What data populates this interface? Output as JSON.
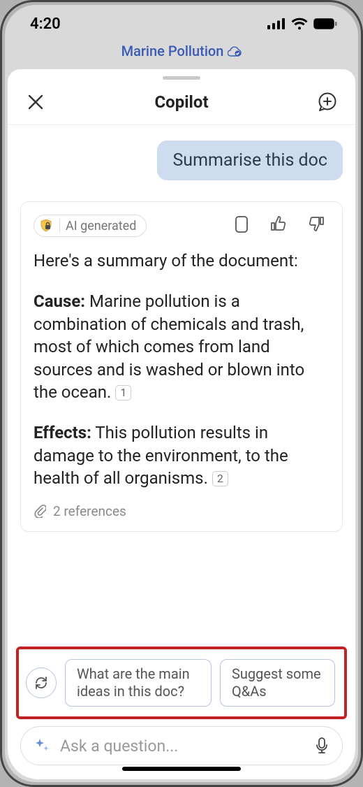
{
  "status": {
    "time": "4:20"
  },
  "doc": {
    "title": "Marine Pollution"
  },
  "sheet": {
    "title": "Copilot"
  },
  "user_message": "Summarise this doc",
  "ai": {
    "chip_label": "AI generated",
    "intro": "Here's a summary of the document:",
    "sections": [
      {
        "heading": "Cause:",
        "body": "Marine pollution is a combination of chemicals and trash, most of which comes from land sources and is washed or blown into the ocean.",
        "cite": "1"
      },
      {
        "heading": "Effects:",
        "body": "This pollution results in damage to the environment, to the health of all organisms.",
        "cite": "2"
      }
    ],
    "references_label": "2 references"
  },
  "suggestions": [
    "What are the main ideas in this doc?",
    "Suggest some Q&As"
  ],
  "input": {
    "placeholder": "Ask a question..."
  }
}
